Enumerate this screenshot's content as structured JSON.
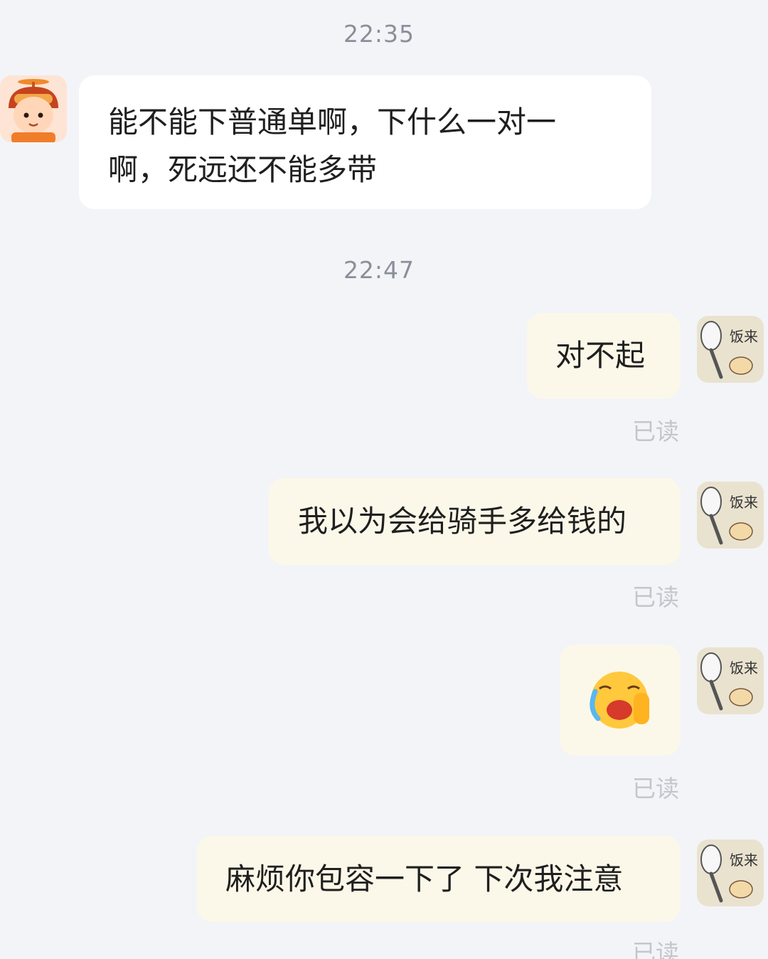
{
  "messages": {
    "time1": "22:35",
    "incoming_text": "能不能下普通单啊，下什么一对一啊，死远还不能多带",
    "time2": "22:47",
    "out1": "对不起",
    "out2": "我以为会给骑手多给钱的",
    "out3_emoji": "😭",
    "out4": "麻烦你包容一下了 下次我注意",
    "read_label": "已读",
    "my_avatar_text": "饭来"
  },
  "colors": {
    "background": "#f3f4f8",
    "incoming_bubble": "#ffffff",
    "outgoing_bubble": "#fcf8e9",
    "timestamp": "#8a8f99",
    "read_status": "#c3c6cc"
  }
}
